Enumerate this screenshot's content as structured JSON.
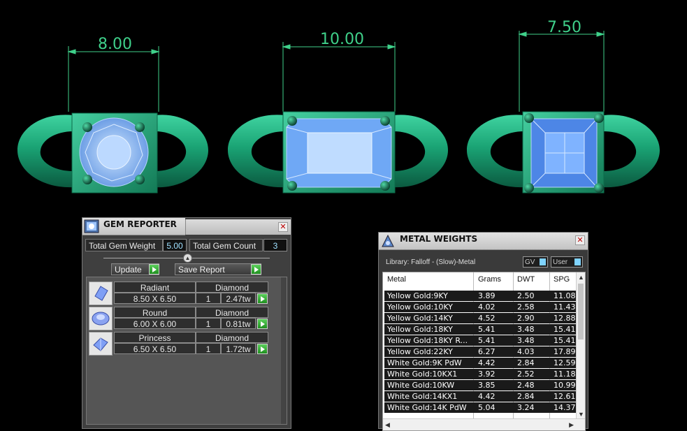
{
  "viewport": {
    "dimensions": [
      "8.00",
      "10.00",
      "7.50"
    ],
    "colors": {
      "metal": "#1aa374",
      "gem": "#6fa8f5",
      "dimension": "#3fd08a",
      "background": "#000000"
    }
  },
  "gem_reporter": {
    "title": "GEM REPORTER",
    "total_gem_weight_label": "Total Gem Weight",
    "total_gem_weight": "5.00",
    "total_gem_count_label": "Total Gem Count",
    "total_gem_count": "3",
    "update_label": "Update",
    "save_report_label": "Save Report",
    "gems": [
      {
        "shape": "Radiant",
        "material": "Diamond",
        "size": "8.50 X 6.50",
        "count": "1",
        "weight": "2.47tw"
      },
      {
        "shape": "Round",
        "material": "Diamond",
        "size": "6.00 X 6.00",
        "count": "1",
        "weight": "0.81tw"
      },
      {
        "shape": "Princess",
        "material": "Diamond",
        "size": "6.50 X 6.50",
        "count": "1",
        "weight": "1.72tw"
      }
    ]
  },
  "metal_weights": {
    "title": "METAL WEIGHTS",
    "library": "Library: Falloff - (Slow)-Metal",
    "gv_label": "GV",
    "user_label": "User",
    "columns": [
      "Metal",
      "Grams",
      "DWT",
      "SPG"
    ],
    "rows": [
      [
        "Yellow Gold:9KY",
        "3.89",
        "2.50",
        "11.08"
      ],
      [
        "Yellow Gold:10KY",
        "4.02",
        "2.58",
        "11.43"
      ],
      [
        "Yellow Gold:14KY",
        "4.52",
        "2.90",
        "12.88"
      ],
      [
        "Yellow Gold:18KY",
        "5.41",
        "3.48",
        "15.41"
      ],
      [
        "Yellow Gold:18KY R...",
        "5.41",
        "3.48",
        "15.41"
      ],
      [
        "Yellow Gold:22KY",
        "6.27",
        "4.03",
        "17.89"
      ],
      [
        "White Gold:9K PdW",
        "4.42",
        "2.84",
        "12.59"
      ],
      [
        "White Gold:10KX1",
        "3.92",
        "2.52",
        "11.18"
      ],
      [
        "White Gold:10KW",
        "3.85",
        "2.48",
        "10.99"
      ],
      [
        "White Gold:14KX1",
        "4.42",
        "2.84",
        "12.61"
      ],
      [
        "White Gold:14K PdW",
        "5.04",
        "3.24",
        "14.37"
      ]
    ]
  }
}
